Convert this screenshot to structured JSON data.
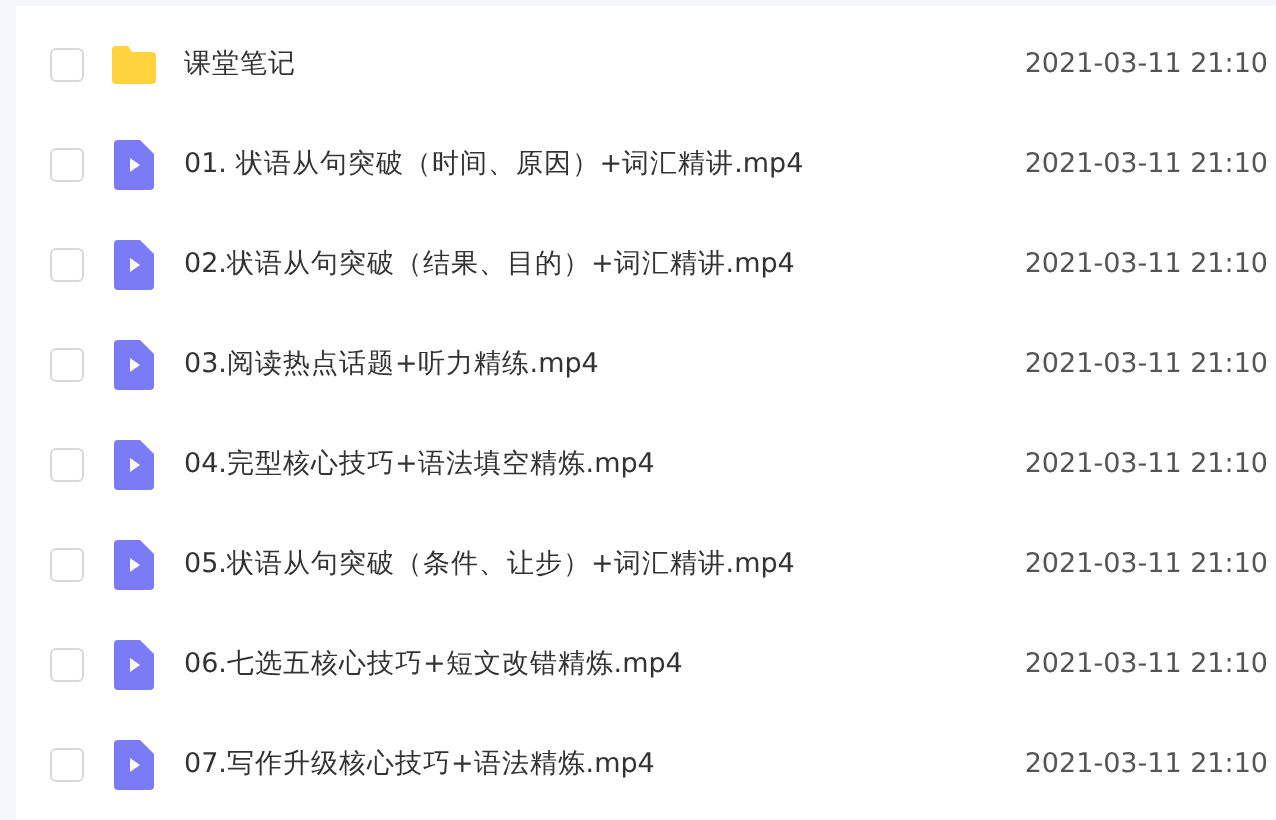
{
  "files": [
    {
      "kind": "folder",
      "name": "课堂笔记",
      "modified": "2021-03-11 21:10",
      "checked": false
    },
    {
      "kind": "video",
      "name": "01. 状语从句突破（时间、原因）+词汇精讲.mp4",
      "modified": "2021-03-11 21:10",
      "checked": false
    },
    {
      "kind": "video",
      "name": "02.状语从句突破（结果、目的）+词汇精讲.mp4",
      "modified": "2021-03-11 21:10",
      "checked": false
    },
    {
      "kind": "video",
      "name": "03.阅读热点话题+听力精练.mp4",
      "modified": "2021-03-11 21:10",
      "checked": false
    },
    {
      "kind": "video",
      "name": "04.完型核心技巧+语法填空精炼.mp4",
      "modified": "2021-03-11 21:10",
      "checked": false
    },
    {
      "kind": "video",
      "name": "05.状语从句突破（条件、让步）+词汇精讲.mp4",
      "modified": "2021-03-11 21:10",
      "checked": false
    },
    {
      "kind": "video",
      "name": "06.七选五核心技巧+短文改错精炼.mp4",
      "modified": "2021-03-11 21:10",
      "checked": false
    },
    {
      "kind": "video",
      "name": "07.写作升级核心技巧+语法精炼.mp4",
      "modified": "2021-03-11 21:10",
      "checked": false
    }
  ]
}
